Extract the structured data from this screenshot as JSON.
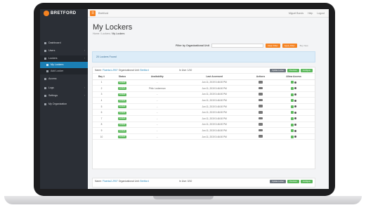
{
  "brand": {
    "logo_text": "BRETFORD",
    "accent": "#f58220",
    "sidebar_bg": "#2b2f36",
    "highlight": "#1b7fb4"
  },
  "topbar": {
    "menu_icon": "menu-icon",
    "crumb": "Bretford",
    "user": "Miguel Bonds",
    "help": "Help",
    "logout": "Logout"
  },
  "sidebar": {
    "items": [
      {
        "label": "Dashboard",
        "icon": "dashboard-icon",
        "chevron": ""
      },
      {
        "label": "Users",
        "icon": "users-icon",
        "chevron": "›"
      },
      {
        "label": "Lockers",
        "icon": "lockers-icon",
        "chevron": "‹"
      },
      {
        "label": "My Lockers",
        "icon": "",
        "chevron": ""
      },
      {
        "label": "Add Locker",
        "icon": "",
        "chevron": ""
      },
      {
        "label": "Access",
        "icon": "access-icon",
        "chevron": ""
      },
      {
        "label": "Logs",
        "icon": "logs-icon",
        "chevron": "›"
      },
      {
        "label": "Settings",
        "icon": "settings-icon",
        "chevron": "›"
      },
      {
        "label": "My Organization",
        "icon": "organization-icon",
        "chevron": ""
      }
    ]
  },
  "page": {
    "title": "My Lockers",
    "breadcrumb": {
      "home": "Home",
      "sep": "/",
      "lockers": "Lockers",
      "current": "My Lockers"
    }
  },
  "filter": {
    "label": "Filter by Organizational Unit",
    "value": "",
    "clear": "Clear Filter",
    "apply": "Apply Filter",
    "buy": "Buy New"
  },
  "alert": {
    "text": "20 Lockers Found"
  },
  "panel1": {
    "name_label": "Name:",
    "name": "Fluenta1-2907",
    "ou_label": "Organizational Unit:",
    "ou": "Bretford",
    "inuse_label": "In Use:",
    "inuse": "1/10",
    "btn_grey": "Update Locker",
    "btn_green1": "Provision",
    "btn_green2": "Configure"
  },
  "table": {
    "headers": [
      "Bay #",
      "Status",
      "Availability",
      "Last Accessed",
      "Actions",
      "Allow Access"
    ],
    "rows": [
      {
        "bay": "1",
        "status": "Locked",
        "availability": "-",
        "last": "Jun 11, 2019 3:46:00 PM"
      },
      {
        "bay": "2",
        "status": "Locked",
        "availability": "Philo Lockerman",
        "last": "Jun 11, 2019 3:46:00 PM"
      },
      {
        "bay": "3",
        "status": "Locked",
        "availability": "-",
        "last": "Jun 11, 2019 3:46:00 PM"
      },
      {
        "bay": "4",
        "status": "Locked",
        "availability": "-",
        "last": "Jun 11, 2019 3:46:00 PM"
      },
      {
        "bay": "5",
        "status": "Locked",
        "availability": "-",
        "last": "Jun 11, 2019 3:46:00 PM"
      },
      {
        "bay": "6",
        "status": "Locked",
        "availability": "-",
        "last": "Jun 11, 2019 3:46:00 PM"
      },
      {
        "bay": "7",
        "status": "Locked",
        "availability": "-",
        "last": "Jun 11, 2019 3:46:00 PM"
      },
      {
        "bay": "8",
        "status": "Locked",
        "availability": "-",
        "last": "Jun 11, 2019 3:46:00 PM"
      },
      {
        "bay": "9",
        "status": "Locked",
        "availability": "-",
        "last": "Jun 11, 2019 3:46:00 PM"
      },
      {
        "bay": "10",
        "status": "Locked",
        "availability": "-",
        "last": "Jun 11, 2019 3:46:00 PM"
      }
    ]
  },
  "panel2": {
    "name_label": "Name:",
    "name": "Fluenta2-2907",
    "ou_label": "Organizational Unit:",
    "ou": "Bretford",
    "inuse_label": "In Use:",
    "inuse": "0/10",
    "btn_grey": "Update Locker",
    "btn_green1": "Provision",
    "btn_green2": "Configure"
  }
}
